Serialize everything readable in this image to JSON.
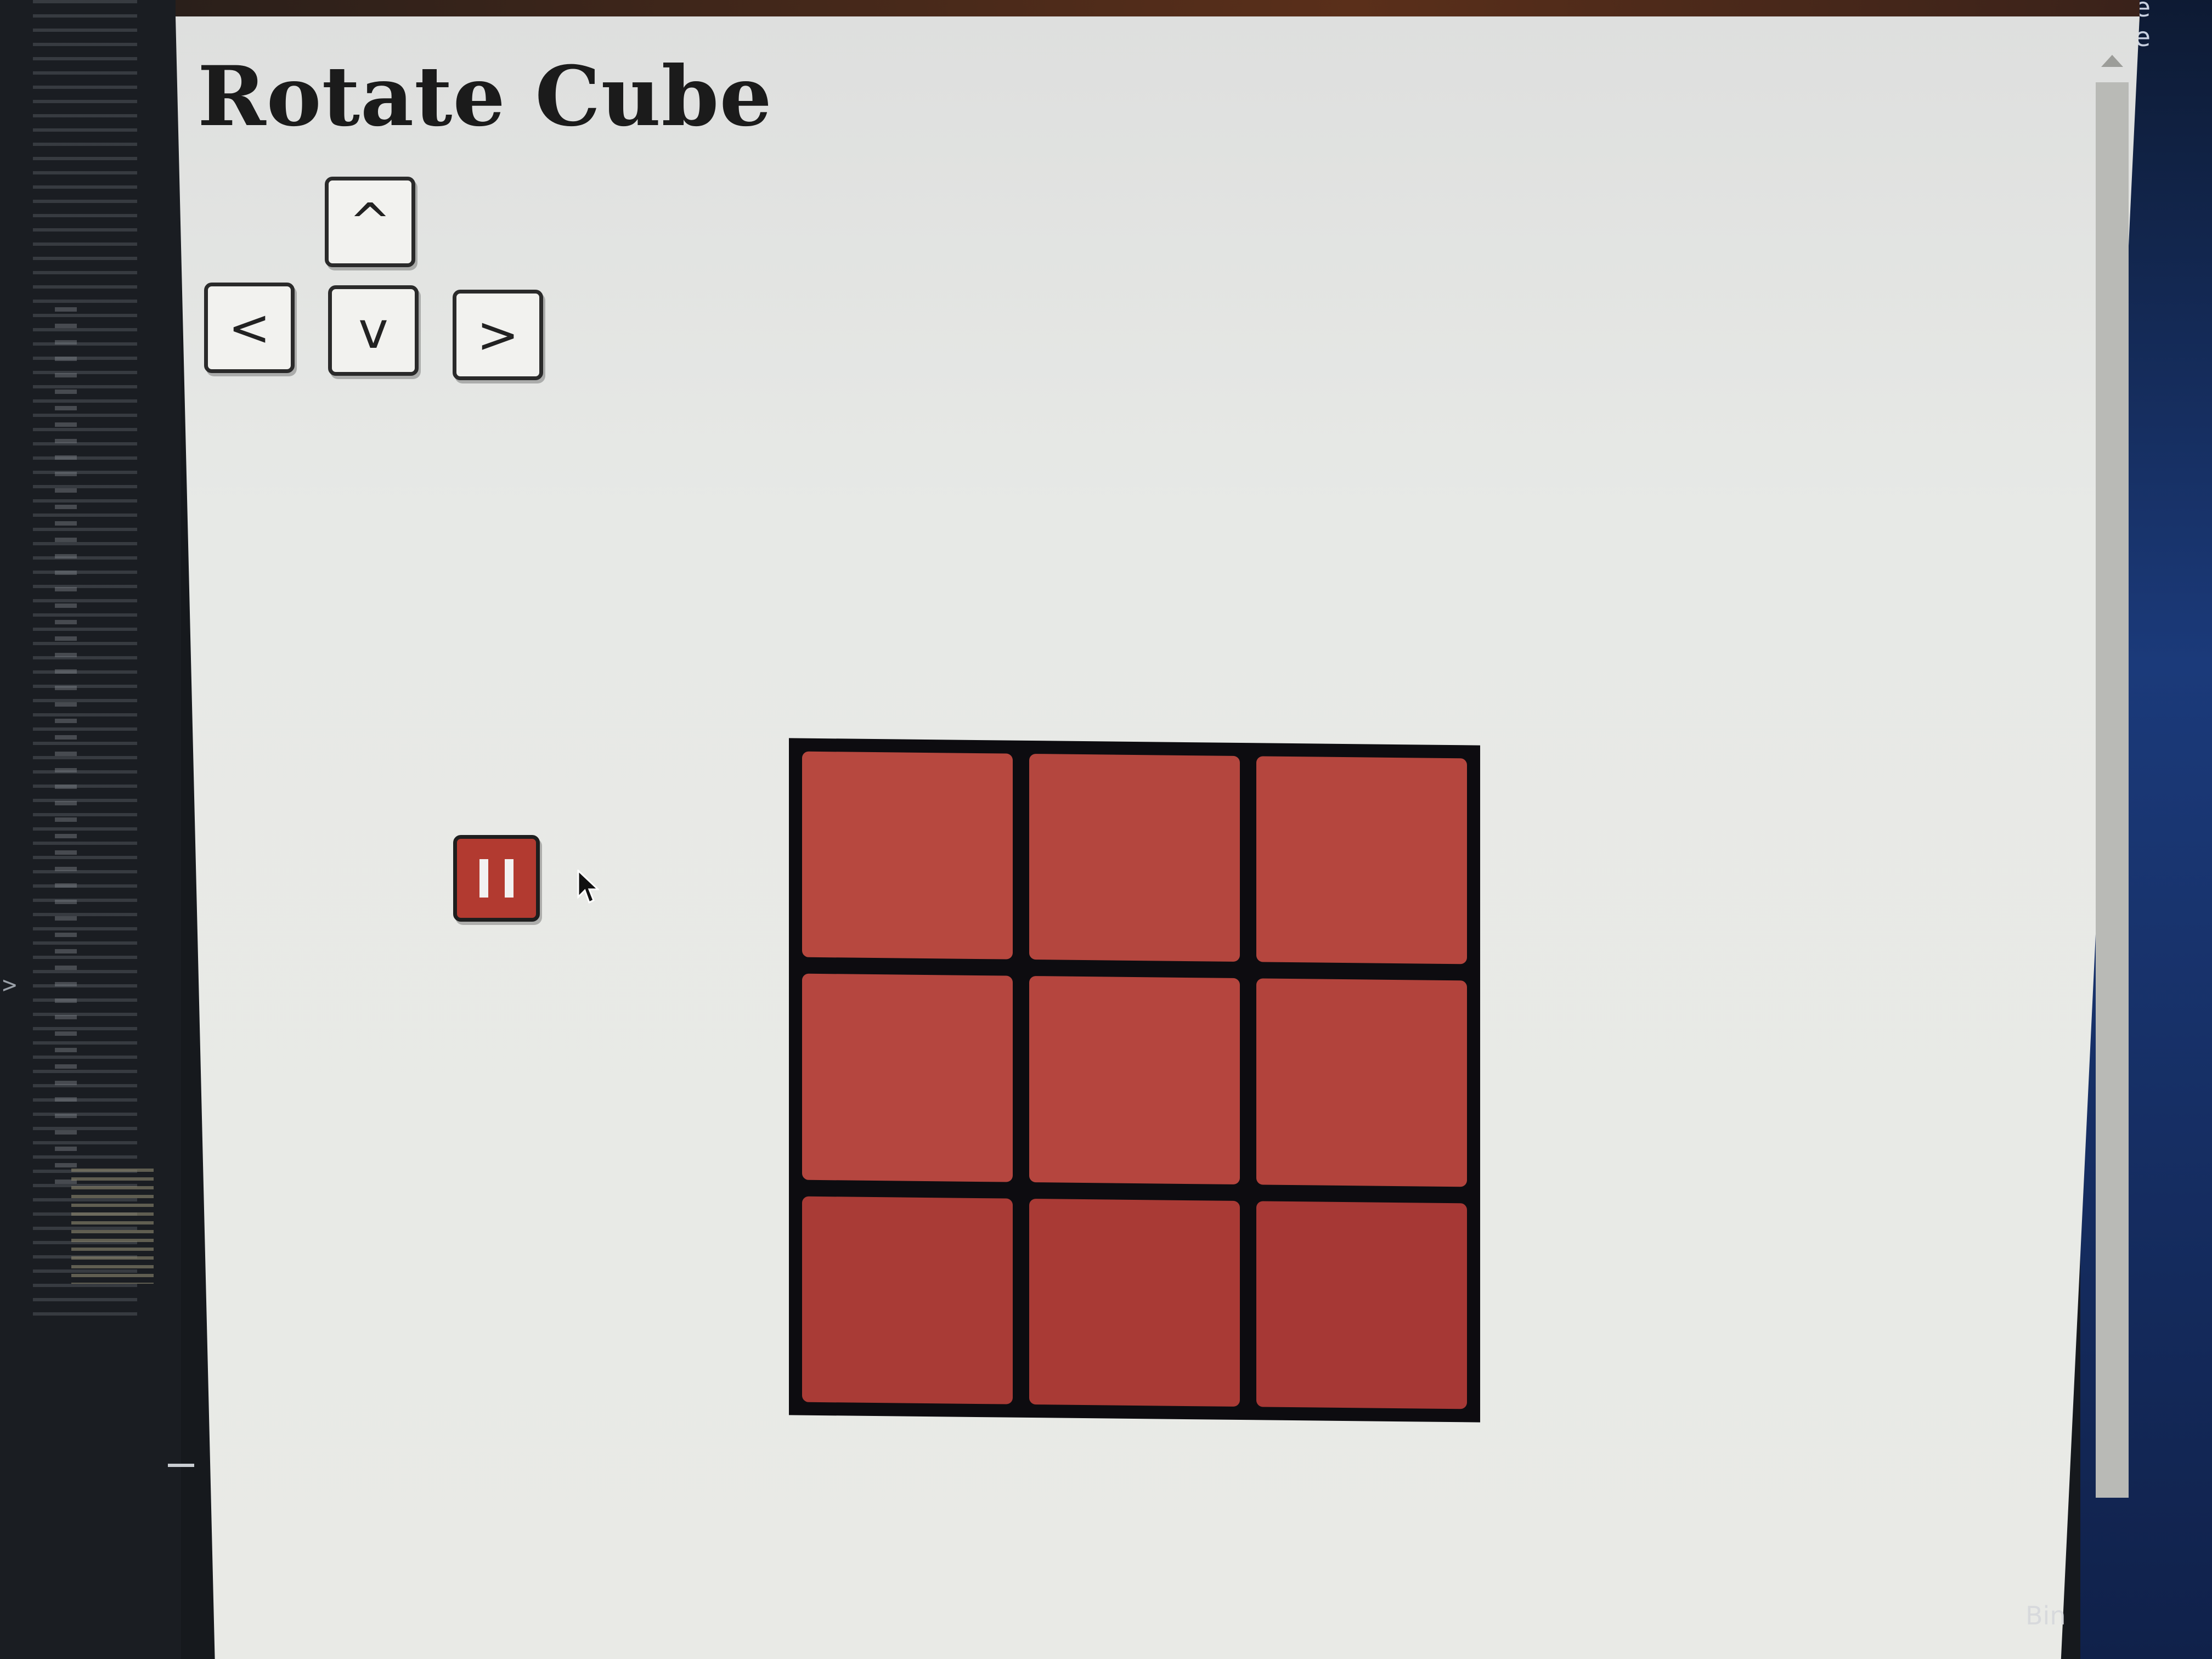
{
  "page": {
    "title": "Rotate Cube"
  },
  "controls": {
    "up_label": "^",
    "left_label": "<",
    "down_label": "v",
    "right_label": ">",
    "pause_icon": "pause-icon"
  },
  "cube": {
    "face_colors": [
      "#b7483f",
      "#b4463e",
      "#b5463e",
      "#b5463f",
      "#b5453e",
      "#b2433c",
      "#a93b36",
      "#a93a35",
      "#a63835"
    ],
    "grid_color": "#0d0c10"
  },
  "colors": {
    "pause_button": "#b23a30",
    "page_background": "#e7e9e6"
  },
  "background": {
    "right_edge_letters": [
      "e",
      "e"
    ],
    "taskbar_text": "Bin"
  }
}
